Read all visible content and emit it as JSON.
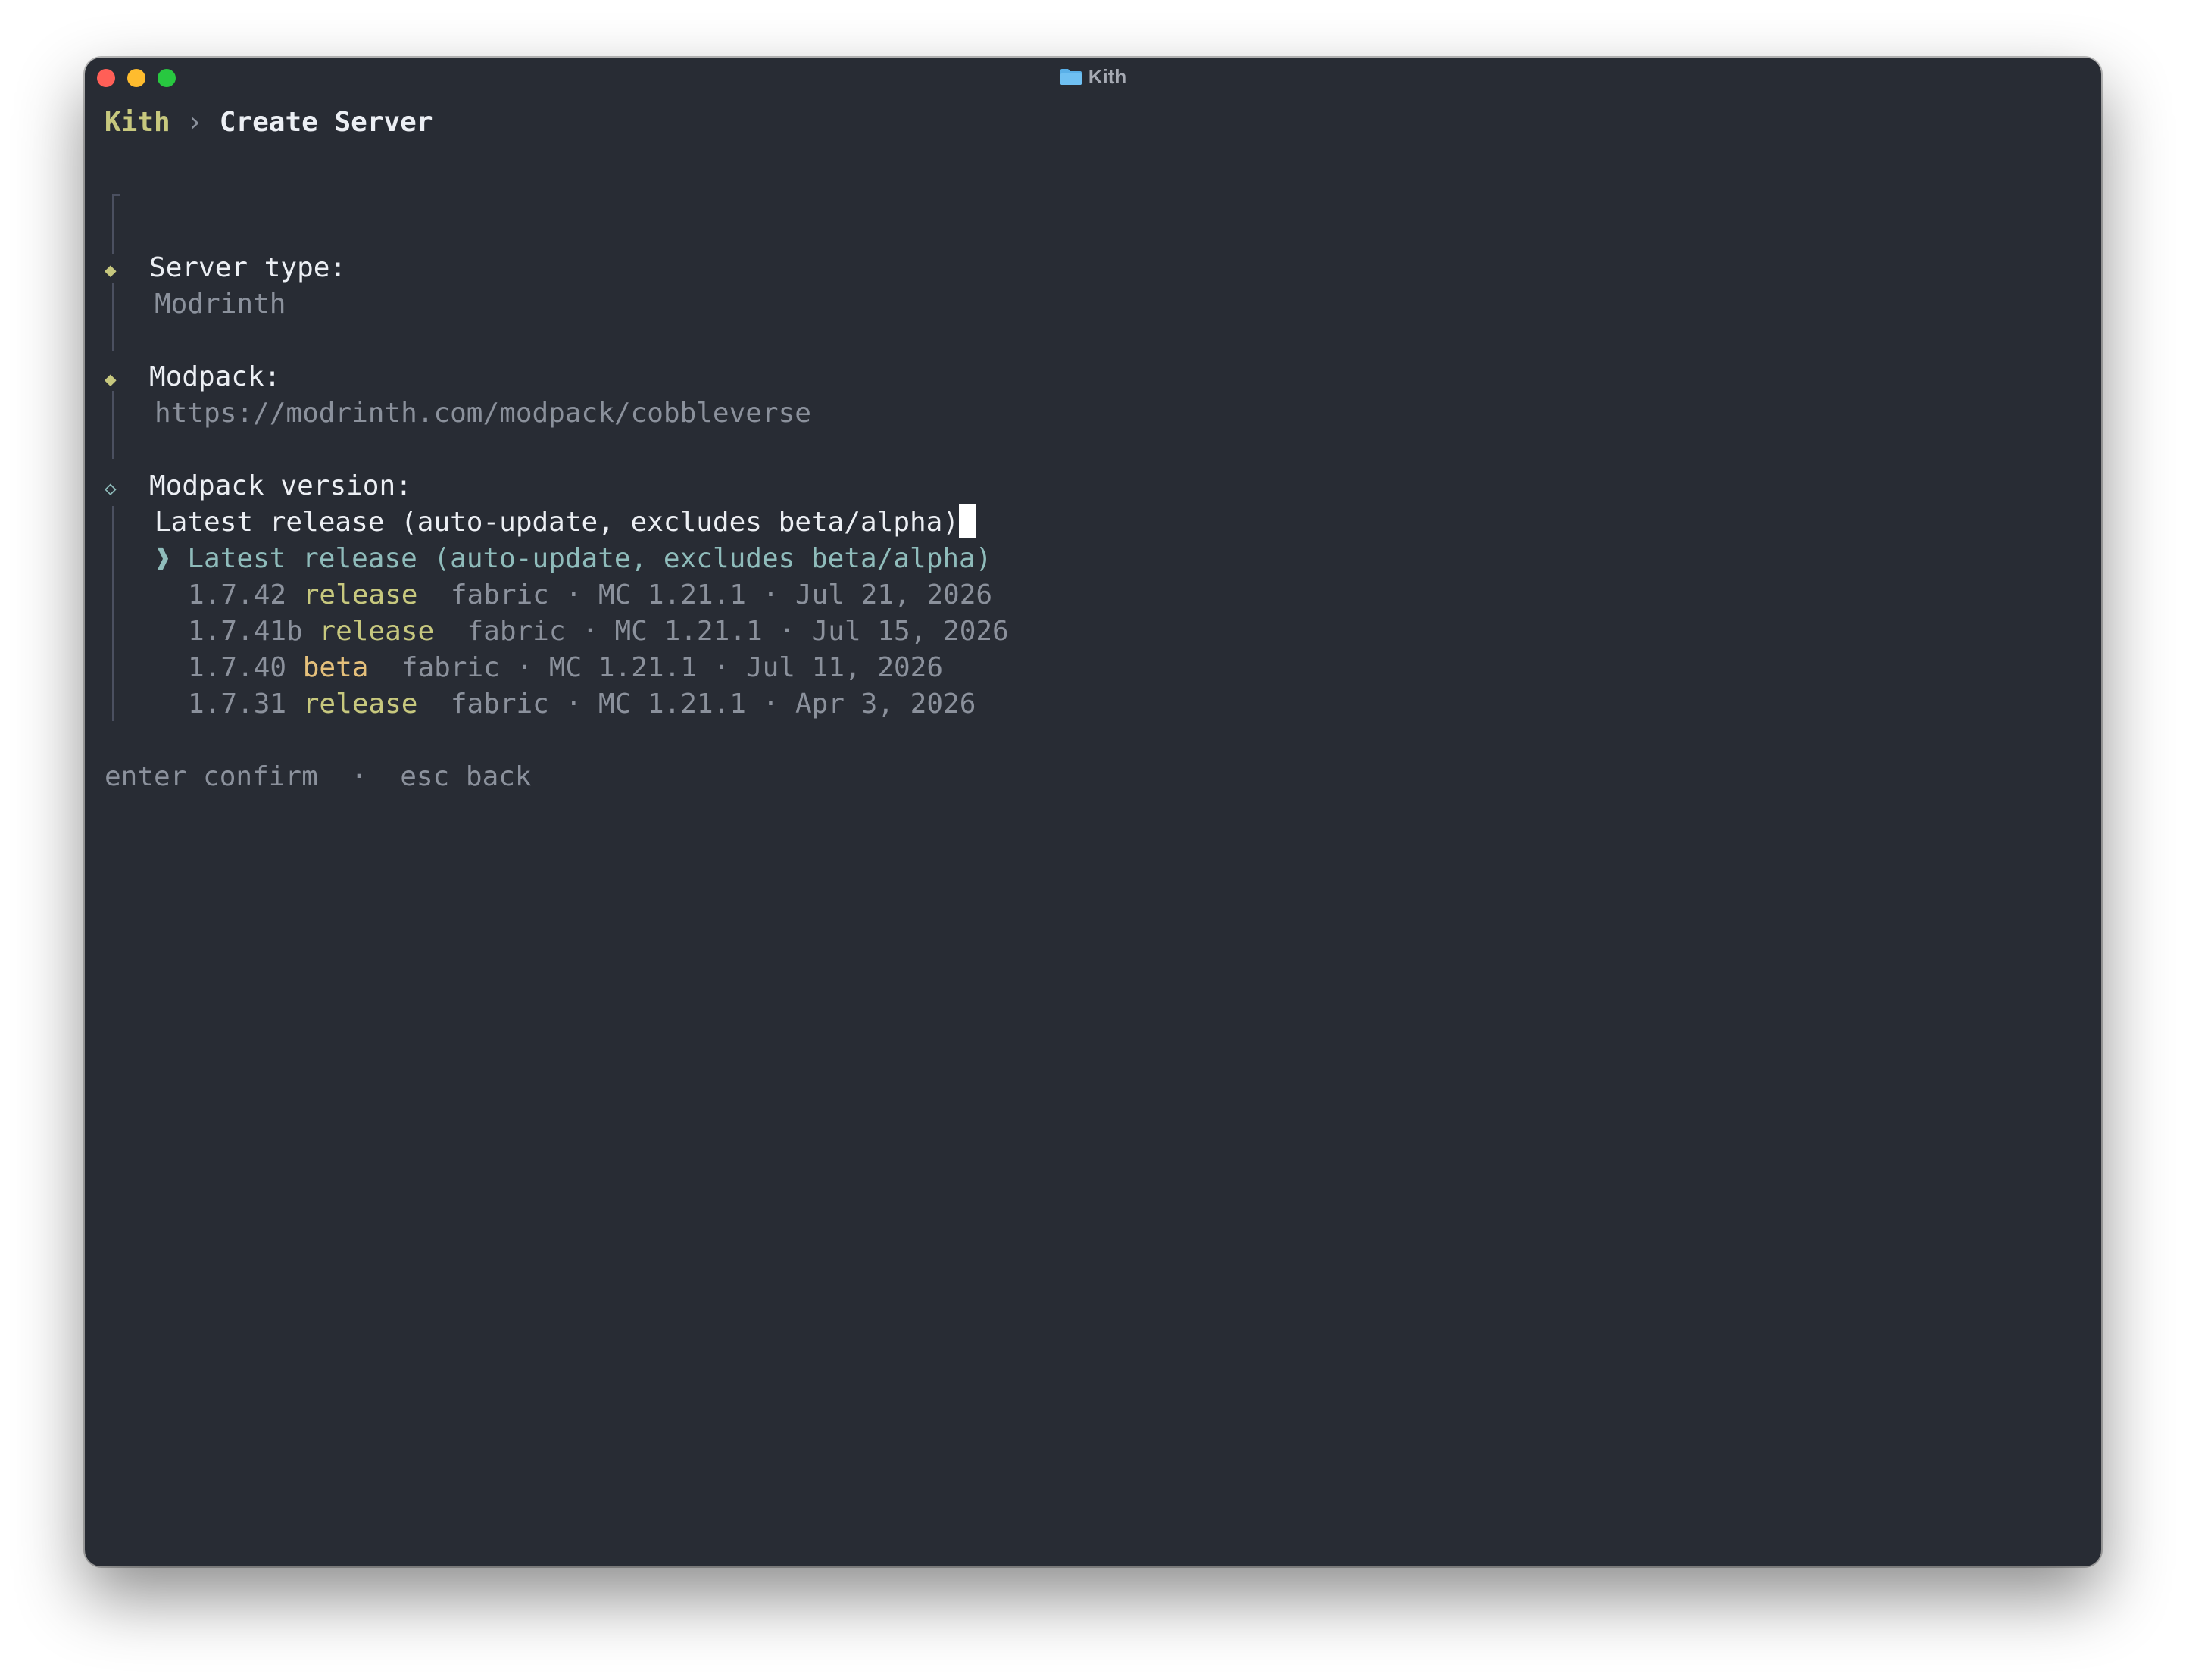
{
  "window": {
    "title": "Kith"
  },
  "breadcrumb": {
    "root": "Kith",
    "separator": "›",
    "current": "Create Server"
  },
  "fields": [
    {
      "label": "Server type:",
      "value": "Modrinth",
      "marker": "◆"
    },
    {
      "label": "Modpack:",
      "value": "https://modrinth.com/modpack/cobbleverse",
      "marker": "◆"
    },
    {
      "label": "Modpack version:",
      "value": "Latest release (auto-update, excludes beta/alpha)",
      "marker": "◇"
    }
  ],
  "options": {
    "pointer": "❱",
    "selected": "Latest release (auto-update, excludes beta/alpha)",
    "items": [
      {
        "version": "1.7.42",
        "channel": "release",
        "meta": "fabric · MC 1.21.1 · Jul 21, 2026"
      },
      {
        "version": "1.7.41b",
        "channel": "release",
        "meta": "fabric · MC 1.21.1 · Jul 15, 2026"
      },
      {
        "version": "1.7.40",
        "channel": "beta",
        "meta": "fabric · MC 1.21.1 · Jul 11, 2026"
      },
      {
        "version": "1.7.31",
        "channel": "release",
        "meta": "fabric · MC 1.21.1 · Apr 3, 2026"
      }
    ]
  },
  "footer": {
    "enter_key": "enter",
    "enter_action": "confirm",
    "separator": "·",
    "esc_key": "esc",
    "esc_action": "back"
  },
  "colors": {
    "background": "#282c34",
    "accent_green": "#c7c87e",
    "beta_yellow": "#e5c07b",
    "selected_teal": "#8fbcbb",
    "muted_gray": "#8b919c",
    "folder_blue": "#5ab0e8"
  },
  "icons": {
    "folder": "folder-icon",
    "done_marker": "filled-diamond",
    "active_marker": "hollow-diamond",
    "pointer": "chevron-right"
  }
}
